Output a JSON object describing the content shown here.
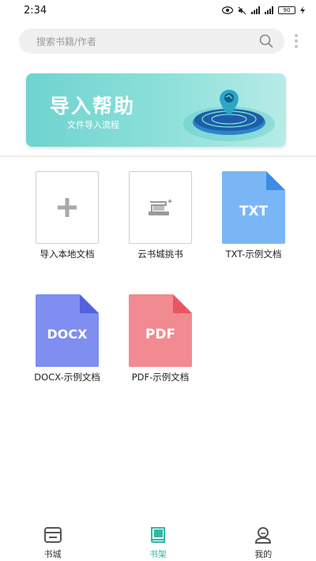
{
  "status_bar": {
    "time": "2:34",
    "battery": "90"
  },
  "search": {
    "placeholder": "搜索书籍/作者"
  },
  "banner": {
    "title": "导入帮助",
    "subtitle": "文件导入流程"
  },
  "shelf_items": [
    {
      "label": "导入本地文档"
    },
    {
      "label": "云书城挑书"
    },
    {
      "label": "TXT-示例文档",
      "badge": "TXT",
      "color": "#7ab6f5",
      "fold": "#3b8ce6"
    },
    {
      "label": "DOCX-示例文档",
      "badge": "DOCX",
      "color": "#7f8ef0",
      "fold": "#5560dd"
    },
    {
      "label": "PDF-示例文档",
      "badge": "PDF",
      "color": "#f28a91",
      "fold": "#e95660"
    }
  ],
  "bottom_nav": [
    {
      "label": "书城",
      "icon": "store-icon"
    },
    {
      "label": "书架",
      "icon": "bookshelf-icon",
      "active": true
    },
    {
      "label": "我的",
      "icon": "profile-icon"
    }
  ],
  "colors": {
    "accent": "#2fb8a4",
    "banner": "#6fd3cf"
  }
}
